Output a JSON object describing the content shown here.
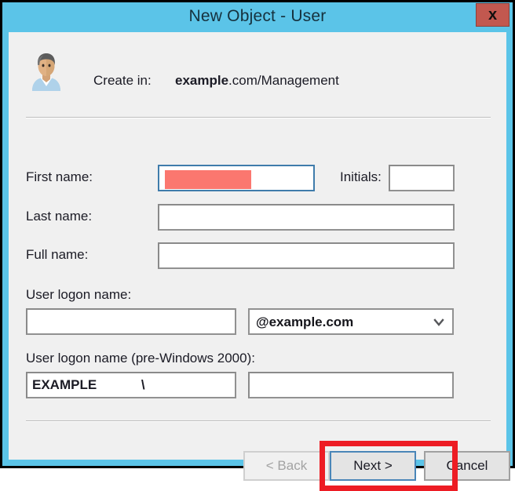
{
  "window": {
    "title": "New Object - User",
    "close_label": "x",
    "titlebar_color": "#5BC4E8",
    "close_button_color": "#C2584F",
    "content_background": "#F0F0F0",
    "frame_border_color": "#000000"
  },
  "header": {
    "icon": "user-avatar-icon",
    "create_in_label": "Create in:",
    "create_in_domain": "example",
    "create_in_path": ".com/Management"
  },
  "form": {
    "first_name": {
      "label": "First name:",
      "value": "",
      "placeholder": "",
      "focused": true,
      "redacted": true,
      "redaction_color": "#FB776F"
    },
    "initials": {
      "label": "Initials:",
      "value": "",
      "placeholder": ""
    },
    "last_name": {
      "label": "Last name:",
      "value": "",
      "placeholder": ""
    },
    "full_name": {
      "label": "Full name:",
      "value": "",
      "placeholder": ""
    },
    "user_logon_name": {
      "label": "User logon name:",
      "value": "",
      "placeholder": "",
      "domain_suffix": "@example.com",
      "domain_arrow": "chevron-down-icon"
    },
    "user_logon_name_legacy": {
      "label": "User logon name (pre-Windows 2000):",
      "netbios_domain": "EXAMPLE            \\",
      "value": "",
      "placeholder": ""
    }
  },
  "buttons": {
    "back": {
      "label": "< Back",
      "disabled": true
    },
    "next": {
      "label": "Next >",
      "disabled": false,
      "focused": true
    },
    "cancel": {
      "label": "Cancel",
      "disabled": false
    }
  },
  "annotation": {
    "target": "next-button",
    "color": "#ED1C24"
  }
}
